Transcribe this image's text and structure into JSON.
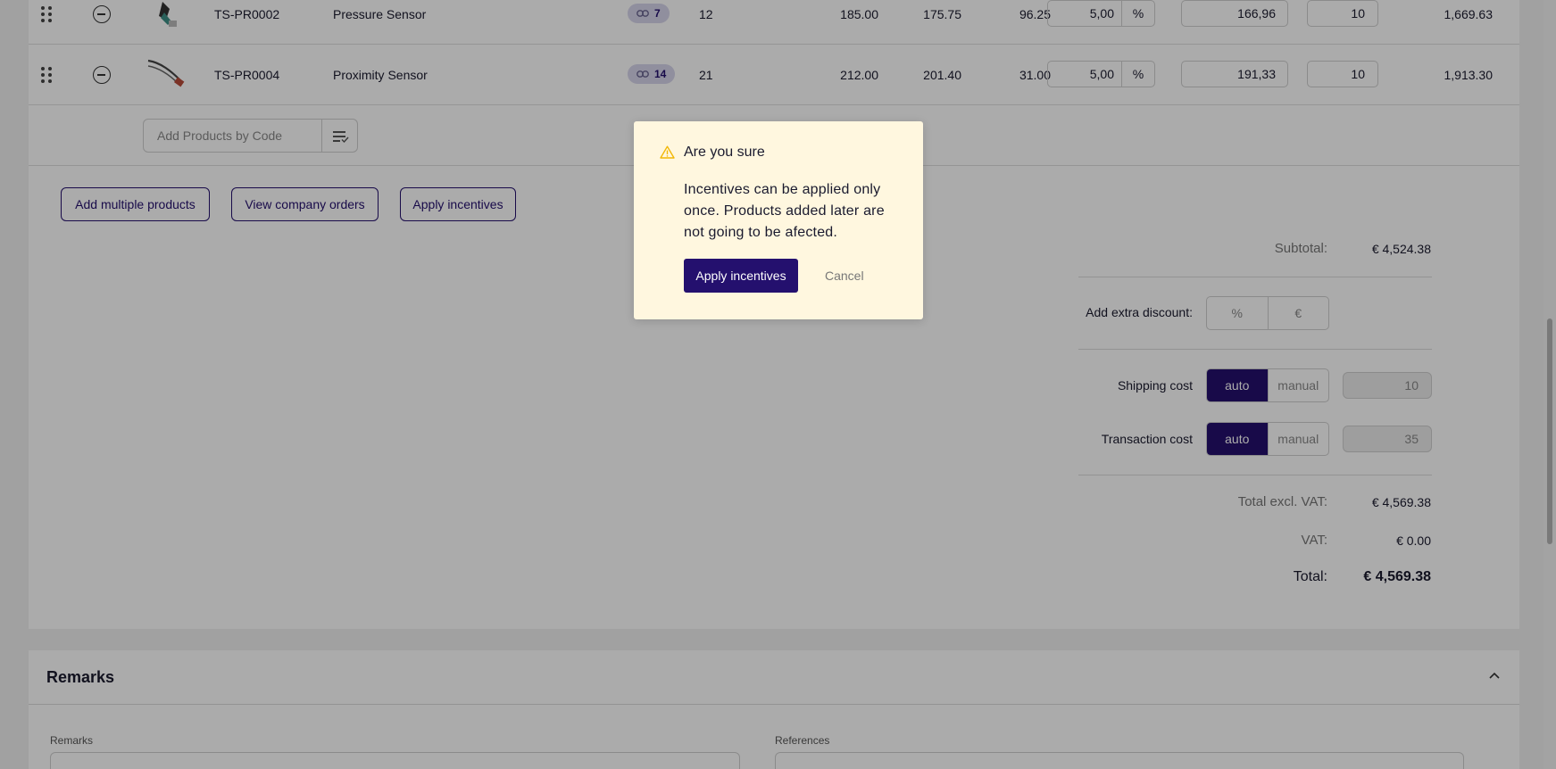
{
  "products": [
    {
      "code": "TS-PR0002",
      "name": "Pressure Sensor",
      "linked_count": "7",
      "qty": "12",
      "price_a": "185.00",
      "price_b": "175.75",
      "price_c": "96.25",
      "discount": "5,00",
      "discount_unit": "%",
      "net_price": "166,96",
      "order_qty": "10",
      "line_total": "1,669.63"
    },
    {
      "code": "TS-PR0004",
      "name": "Proximity Sensor",
      "linked_count": "14",
      "qty": "21",
      "price_a": "212.00",
      "price_b": "201.40",
      "price_c": "31.00",
      "discount": "5,00",
      "discount_unit": "%",
      "net_price": "191,33",
      "order_qty": "10",
      "line_total": "1,913.30"
    }
  ],
  "add_by_code": {
    "placeholder": "Add Products by Code"
  },
  "actions": {
    "add_multiple": "Add multiple products",
    "view_company_orders": "View company orders",
    "apply_incentives": "Apply incentives"
  },
  "summary": {
    "subtotal_label": "Subtotal:",
    "subtotal_value": "€ 4,524.38",
    "extra_discount_label": "Add extra discount:",
    "extra_discount_percent": "%",
    "extra_discount_euro": "€",
    "shipping_label": "Shipping cost",
    "shipping_auto": "auto",
    "shipping_manual": "manual",
    "shipping_value": "10",
    "transaction_label": "Transaction cost",
    "transaction_auto": "auto",
    "transaction_manual": "manual",
    "transaction_value": "35",
    "total_excl_label": "Total excl. VAT:",
    "total_excl_value": "€ 4,569.38",
    "vat_label": "VAT:",
    "vat_value": "€ 0.00",
    "total_label": "Total:",
    "total_value": "€ 4,569.38"
  },
  "remarks": {
    "title": "Remarks",
    "remarks_label": "Remarks",
    "references_label": "References"
  },
  "dialog": {
    "title": "Are you sure",
    "message": "Incentives can be applied only once. Products added later are not going to be afected.",
    "confirm": "Apply incentives",
    "cancel": "Cancel"
  },
  "colors": {
    "accent": "#24106e",
    "dialog_bg": "#fff7df",
    "warning": "#f2b705"
  }
}
